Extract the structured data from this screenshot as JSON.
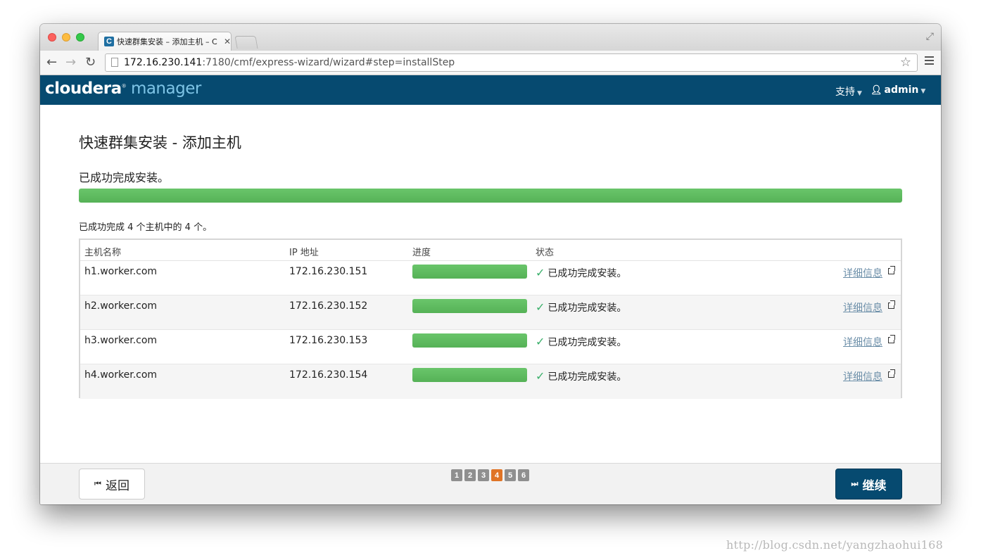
{
  "browser": {
    "tab_title": "快速群集安装 – 添加主机 – C",
    "tab_favicon": "C",
    "url_host": "172.16.230.141",
    "url_rest": ":7180/cmf/express-wizard/wizard#step=installStep"
  },
  "header": {
    "logo_part1": "cloudera",
    "logo_reg": "®",
    "logo_part2": "manager",
    "support_label": "支持",
    "user_label": "admin"
  },
  "page": {
    "title": "快速群集安装 - 添加主机",
    "status_heading": "已成功完成安装。",
    "overall_progress": 1.0,
    "summary": "已成功完成 4 个主机中的 4 个。"
  },
  "table": {
    "headers": {
      "host": "主机名称",
      "ip": "IP 地址",
      "progress": "进度",
      "status": "状态"
    },
    "rows": [
      {
        "host": "h1.worker.com",
        "ip": "172.16.230.151",
        "progress": 1.0,
        "status": "已成功完成安装。",
        "details": "详细信息"
      },
      {
        "host": "h2.worker.com",
        "ip": "172.16.230.152",
        "progress": 1.0,
        "status": "已成功完成安装。",
        "details": "详细信息"
      },
      {
        "host": "h3.worker.com",
        "ip": "172.16.230.153",
        "progress": 1.0,
        "status": "已成功完成安装。",
        "details": "详细信息"
      },
      {
        "host": "h4.worker.com",
        "ip": "172.16.230.154",
        "progress": 1.0,
        "status": "已成功完成安装。",
        "details": "详细信息"
      }
    ]
  },
  "footer": {
    "back_label": "返回",
    "continue_label": "继续",
    "steps": [
      "1",
      "2",
      "3",
      "4",
      "5",
      "6"
    ],
    "active_step": "4"
  },
  "watermark": "http://blog.csdn.net/yangzhaohui168",
  "colors": {
    "brand": "#064a70",
    "progress": "#5cb85c",
    "active_step": "#e07426",
    "success_check": "#3bb06b"
  }
}
